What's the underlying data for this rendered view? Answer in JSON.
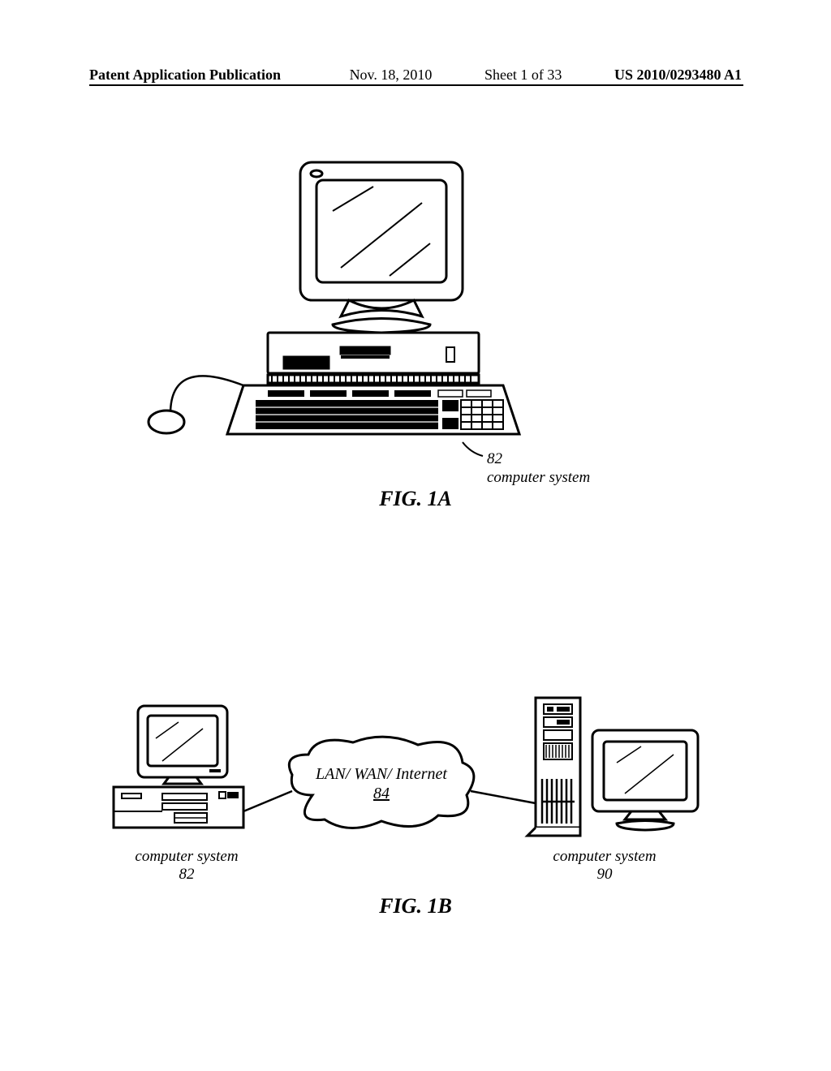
{
  "header": {
    "left": "Patent Application Publication",
    "date": "Nov. 18, 2010",
    "sheet": "Sheet 1 of 33",
    "pubno": "US 2010/0293480 A1"
  },
  "fig1a": {
    "caption": "FIG. 1A",
    "ref_num": "82",
    "ref_label": "computer system"
  },
  "fig1b": {
    "caption": "FIG. 1B",
    "cloud_line1": "LAN/ WAN/ Internet",
    "cloud_ref": "84",
    "left_label": "computer system",
    "left_ref": "82",
    "right_label": "computer system",
    "right_ref": "90"
  }
}
